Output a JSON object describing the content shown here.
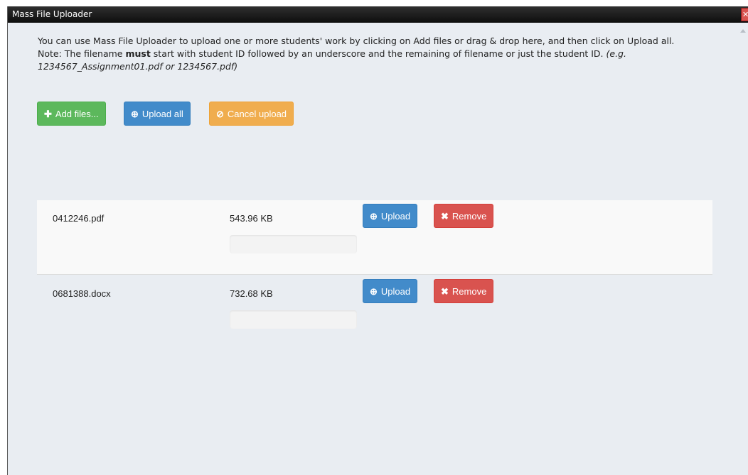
{
  "window": {
    "title": "Mass File Uploader",
    "close_glyph": "✕"
  },
  "instructions": {
    "line1": "You can use Mass File Uploader to upload one or more students' work by clicking on Add files or drag & drop here, and then click on Upload all.",
    "note_prefix": "Note: The filename ",
    "note_emphasis": "must",
    "note_suffix": " start with student ID followed by an underscore and the remaining of filename or just the student ID. ",
    "note_example": "(e.g. 1234567_Assignment01.pdf or 1234567.pdf)"
  },
  "toolbar": {
    "add_files_label": "Add files...",
    "add_files_icon": "plus-icon",
    "upload_all_label": "Upload all",
    "upload_all_icon": "upload-circle-icon",
    "cancel_upload_label": "Cancel upload",
    "cancel_upload_icon": "ban-icon"
  },
  "files": [
    {
      "name": "0412246.pdf",
      "size": "543.96 KB",
      "progress": 0,
      "upload_label": "Upload",
      "remove_label": "Remove"
    },
    {
      "name": "0681388.docx",
      "size": "732.68 KB",
      "progress": 0,
      "upload_label": "Upload",
      "remove_label": "Remove"
    }
  ],
  "colors": {
    "success": "#5cb85c",
    "primary": "#428bca",
    "warning": "#f0ad4e",
    "danger": "#d9534f",
    "dialog_background": "#e9edf2"
  }
}
